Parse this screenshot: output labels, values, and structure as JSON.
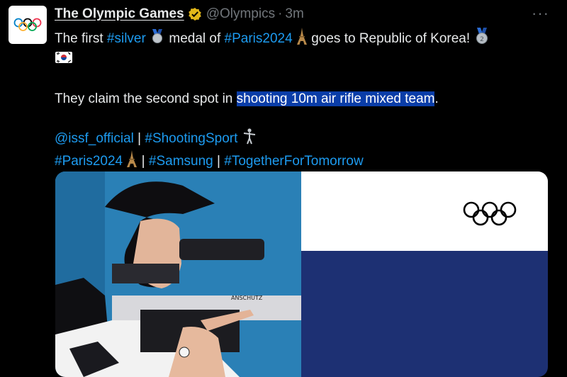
{
  "account": {
    "name": "The Olympic Games",
    "handle": "@Olympics",
    "separator": "·",
    "time": "3m"
  },
  "tweet": {
    "line1": {
      "t1": "The first ",
      "tag1": "#silver",
      "t2": " medal of ",
      "tag2": "#Paris2024",
      "t3": " goes to Republic of Korea! "
    },
    "line3": {
      "t1": "They claim the second spot in ",
      "highlight": "shooting 10m air rifle mixed team",
      "t2": "."
    },
    "line4": {
      "mention": "@issf_official",
      "sep": " | ",
      "tag": "#ShootingSport"
    },
    "line5": {
      "tag1": "#Paris2024",
      "sep1": " | ",
      "tag2": "#Samsung",
      "sep2": " | ",
      "tag3": "#TogetherForTomorrow"
    }
  },
  "icons": [
    "olympic-rings-icon",
    "verified-badge-icon",
    "silver-medal-icon",
    "eiffel-tower-icon",
    "medal-2-icon",
    "korea-flag-icon",
    "shooter-icon",
    "more-icon"
  ],
  "colors": {
    "link": "#1d9bf0",
    "highlight": "#0a3da8",
    "muted": "#71767b",
    "flag_blue": "#1d3073"
  },
  "media": {
    "photo_text": "ANSCHUTZ"
  }
}
